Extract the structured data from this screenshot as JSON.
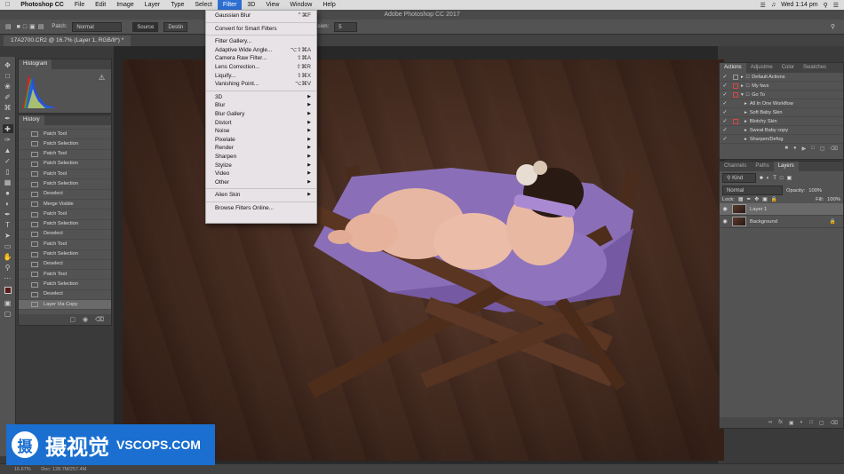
{
  "menubar": {
    "app": "Photoshop CC",
    "items": [
      "File",
      "Edit",
      "Image",
      "Layer",
      "Type",
      "Select",
      "Filter",
      "3D",
      "View",
      "Window",
      "Help"
    ],
    "active": "Filter",
    "clock": "Wed 1:14 pm"
  },
  "window_title": "Adobe Photoshop CC 2017",
  "options": {
    "patch_label": "Patch:",
    "patch_value": "Normal",
    "source_label": "Source",
    "dest_label": "Destin",
    "diffusion_label": "Diffusion:",
    "diffusion_value": "5"
  },
  "doc_tab": "17A2700.CR2 @ 16.7% (Layer 1, RGB/8*) *",
  "filter_menu": {
    "items": [
      {
        "label": "Gaussian Blur",
        "shortcut": "⌃⌘F"
      },
      {
        "sep": true
      },
      {
        "label": "Convert for Smart Filters"
      },
      {
        "sep": true
      },
      {
        "label": "Filter Gallery..."
      },
      {
        "label": "Adaptive Wide Angle...",
        "shortcut": "⌥⇧⌘A"
      },
      {
        "label": "Camera Raw Filter...",
        "shortcut": "⇧⌘A"
      },
      {
        "label": "Lens Correction...",
        "shortcut": "⇧⌘R"
      },
      {
        "label": "Liquify...",
        "shortcut": "⇧⌘X"
      },
      {
        "label": "Vanishing Point...",
        "shortcut": "⌥⌘V"
      },
      {
        "sep": true
      },
      {
        "label": "3D",
        "submenu": true
      },
      {
        "label": "Blur",
        "submenu": true
      },
      {
        "label": "Blur Gallery",
        "submenu": true
      },
      {
        "label": "Distort",
        "submenu": true
      },
      {
        "label": "Noise",
        "submenu": true
      },
      {
        "label": "Pixelate",
        "submenu": true
      },
      {
        "label": "Render",
        "submenu": true
      },
      {
        "label": "Sharpen",
        "submenu": true
      },
      {
        "label": "Stylize",
        "submenu": true
      },
      {
        "label": "Video",
        "submenu": true
      },
      {
        "label": "Other",
        "submenu": true
      },
      {
        "sep": true
      },
      {
        "label": "Alien Skin",
        "submenu": true
      },
      {
        "sep": true
      },
      {
        "label": "Browse Filters Online..."
      }
    ]
  },
  "histogram": {
    "title": "Histogram"
  },
  "history": {
    "title": "History",
    "items": [
      "Patch Tool",
      "Patch Selection",
      "Patch Tool",
      "Patch Selection",
      "Patch Tool",
      "Patch Selection",
      "Deselect",
      "Merge Visible",
      "Patch Tool",
      "Patch Selection",
      "Deselect",
      "Patch Tool",
      "Patch Selection",
      "Deselect",
      "Patch Tool",
      "Patch Selection",
      "Deselect",
      "Layer Via Copy"
    ],
    "selected_index": 17
  },
  "actions_panel": {
    "tabs": [
      "Actions",
      "Adjustme",
      "Color",
      "Swatches"
    ],
    "items": [
      "Default Actions",
      "My favs",
      "Go To",
      "All In One Workflow",
      "Soft Baby Skin",
      "Blotchy Skin",
      "Sweat Baby copy",
      "Sharpen/Defog"
    ]
  },
  "layers_panel": {
    "tabs": [
      "Channels",
      "Paths",
      "Layers"
    ],
    "kind": "Kind",
    "blend_mode": "Normal",
    "opacity_label": "Opacity:",
    "opacity": "100%",
    "lock_label": "Lock:",
    "fill_label": "Fill:",
    "fill": "100%",
    "layers": [
      {
        "name": "Layer 1",
        "selected": true
      },
      {
        "name": "Background",
        "selected": false
      }
    ]
  },
  "status": {
    "zoom": "16.67%",
    "doc": "Doc: 128.7M/257.4M"
  },
  "watermark": {
    "logo": "摄",
    "cn": "摄视觉",
    "en": "VSCOPS.COM"
  }
}
